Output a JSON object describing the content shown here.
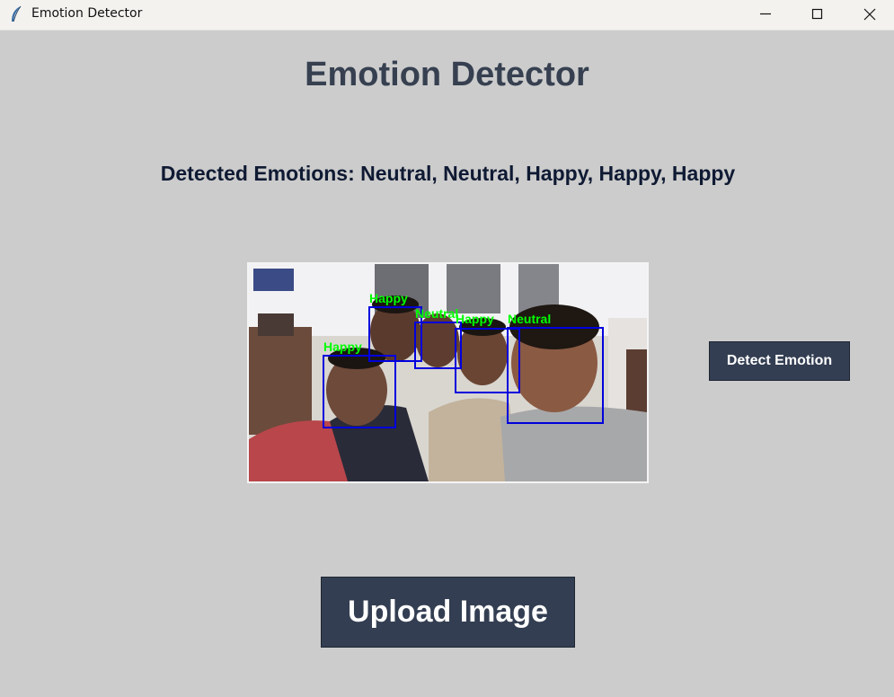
{
  "window": {
    "title": "Emotion Detector",
    "icon": "feather-icon"
  },
  "main": {
    "heading": "Emotion Detector",
    "result_text": "Detected Emotions: Neutral, Neutral, Happy, Happy, Happy",
    "detect_button_label": "Detect Emotion",
    "upload_button_label": "Upload Image"
  },
  "image": {
    "faces": [
      {
        "label": "Happy"
      },
      {
        "label": "Happy"
      },
      {
        "label": "Neutral"
      },
      {
        "label": "Happy"
      },
      {
        "label": "Neutral"
      }
    ]
  },
  "colors": {
    "background": "#cccccc",
    "heading": "#364050",
    "result": "#0f1a33",
    "button_bg": "#333e52",
    "button_text": "#ffffff",
    "box": "#0000dd",
    "label": "#00ff00"
  }
}
